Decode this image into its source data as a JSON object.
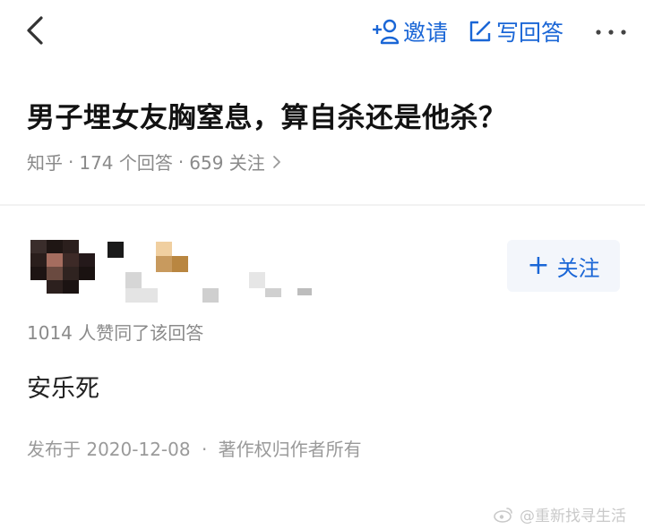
{
  "topbar": {
    "invite_label": "邀请",
    "write_label": "写回答"
  },
  "question": {
    "title": "男子埋女友胸窒息，算自杀还是他杀？",
    "source": "知乎",
    "answer_count": "174 个回答",
    "follower_count": "659 关注"
  },
  "author": {
    "follow_label": "关注"
  },
  "answer": {
    "likes_text": "1014 人赞同了该回答",
    "content": "安乐死",
    "published": "发布于 2020-12-08",
    "copyright": "著作权归作者所有"
  },
  "watermark": {
    "text": "@重新找寻生活"
  },
  "colors": {
    "accent": "#1a66d6",
    "muted_text": "#8a8a8a",
    "title_text": "#121212"
  }
}
